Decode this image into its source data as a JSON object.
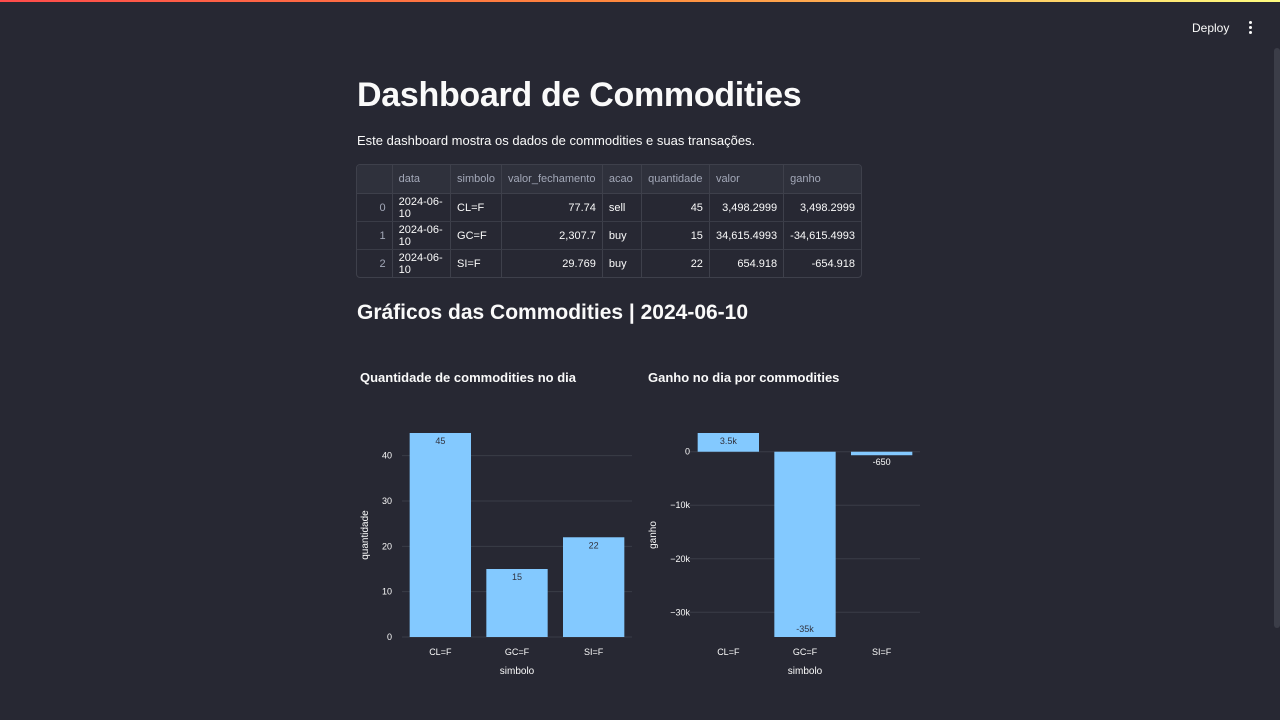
{
  "header": {
    "deploy_label": "Deploy"
  },
  "main": {
    "title": "Dashboard de Commodities",
    "description": "Este dashboard mostra os dados de commodities e suas transações.",
    "subtitle": "Gráficos das Commodities | 2024-06-10"
  },
  "table": {
    "columns": [
      "",
      "data",
      "simbolo",
      "valor_fechamento",
      "acao",
      "quantidade",
      "valor",
      "ganho"
    ],
    "rows": [
      [
        "0",
        "2024-06-10",
        "CL=F",
        "77.74",
        "sell",
        "45",
        "3,498.2999",
        "3,498.2999"
      ],
      [
        "1",
        "2024-06-10",
        "GC=F",
        "2,307.7",
        "buy",
        "15",
        "34,615.4993",
        "-34,615.4993"
      ],
      [
        "2",
        "2024-06-10",
        "SI=F",
        "29.769",
        "buy",
        "22",
        "654.918",
        "-654.918"
      ]
    ]
  },
  "chart_data": [
    {
      "type": "bar",
      "title": "Quantidade de commodities no dia",
      "xlabel": "simbolo",
      "ylabel": "quantidade",
      "categories": [
        "CL=F",
        "GC=F",
        "SI=F"
      ],
      "values": [
        45,
        15,
        22
      ],
      "data_labels": [
        "45",
        "15",
        "22"
      ],
      "yticks": [
        0,
        10,
        20,
        30,
        40
      ],
      "ytick_labels": [
        "0",
        "10",
        "20",
        "30",
        "40"
      ],
      "ylim": [
        0,
        45
      ],
      "bar_color": "#83c9ff",
      "grid": true
    },
    {
      "type": "bar",
      "title": "Ganho no dia por commodities",
      "xlabel": "simbolo",
      "ylabel": "ganho",
      "categories": [
        "CL=F",
        "GC=F",
        "SI=F"
      ],
      "values": [
        3498.2999,
        -34615.4993,
        -654.918
      ],
      "data_labels": [
        "3.5k",
        "-35k",
        "-650"
      ],
      "yticks": [
        0,
        -10000,
        -20000,
        -30000
      ],
      "ytick_labels": [
        "0",
        "−10k",
        "−20k",
        "−30k"
      ],
      "ylim": [
        -34615.4993,
        3498.2999
      ],
      "bar_color": "#83c9ff",
      "grid": true
    }
  ]
}
